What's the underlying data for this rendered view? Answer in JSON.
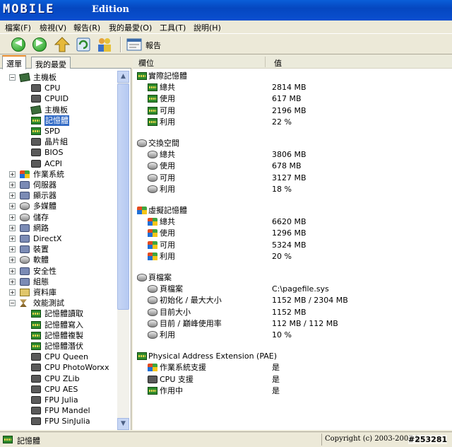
{
  "window": {
    "logo": "MOBILE",
    "edition": "Edition"
  },
  "menu": [
    "檔案(F)",
    "檢視(V)",
    "報告(R)",
    "我的最愛(O)",
    "工具(T)",
    "說明(H)"
  ],
  "toolbar": {
    "report_label": "報告"
  },
  "tabs": [
    "選單",
    "我的最愛"
  ],
  "tree": [
    {
      "label": "主機板",
      "icon": "board",
      "level": 1,
      "expander": "−"
    },
    {
      "label": "CPU",
      "icon": "chip",
      "level": 2
    },
    {
      "label": "CPUID",
      "icon": "chip",
      "level": 2
    },
    {
      "label": "主機板",
      "icon": "board",
      "level": 2
    },
    {
      "label": "記憶體",
      "icon": "ram",
      "level": 2,
      "selected": true
    },
    {
      "label": "SPD",
      "icon": "ram",
      "level": 2
    },
    {
      "label": "晶片組",
      "icon": "chip",
      "level": 2
    },
    {
      "label": "BIOS",
      "icon": "chip",
      "level": 2
    },
    {
      "label": "ACPI",
      "icon": "chip",
      "level": 2
    },
    {
      "label": "作業系統",
      "icon": "win",
      "level": 1,
      "expander": "+"
    },
    {
      "label": "伺服器",
      "icon": "gen",
      "level": 1,
      "expander": "+"
    },
    {
      "label": "顯示器",
      "icon": "gen",
      "level": 1,
      "expander": "+"
    },
    {
      "label": "多媒體",
      "icon": "disk",
      "level": 1,
      "expander": "+"
    },
    {
      "label": "儲存",
      "icon": "disk",
      "level": 1,
      "expander": "+"
    },
    {
      "label": "網路",
      "icon": "gen",
      "level": 1,
      "expander": "+"
    },
    {
      "label": "DirectX",
      "icon": "gen",
      "level": 1,
      "expander": "+"
    },
    {
      "label": "裝置",
      "icon": "gen",
      "level": 1,
      "expander": "+"
    },
    {
      "label": "軟體",
      "icon": "disk",
      "level": 1,
      "expander": "+"
    },
    {
      "label": "安全性",
      "icon": "gen",
      "level": 1,
      "expander": "+"
    },
    {
      "label": "組態",
      "icon": "gen",
      "level": 1,
      "expander": "+"
    },
    {
      "label": "資料庫",
      "icon": "folder",
      "level": 1,
      "expander": "+"
    },
    {
      "label": "效能測試",
      "icon": "hour",
      "level": 1,
      "expander": "−"
    },
    {
      "label": "記憶體讀取",
      "icon": "ram",
      "level": 2
    },
    {
      "label": "記憶體寫入",
      "icon": "ram",
      "level": 2
    },
    {
      "label": "記憶體複製",
      "icon": "ram",
      "level": 2
    },
    {
      "label": "記憶體潛伏",
      "icon": "ram",
      "level": 2
    },
    {
      "label": "CPU Queen",
      "icon": "chip",
      "level": 2
    },
    {
      "label": "CPU PhotoWorxx",
      "icon": "chip",
      "level": 2
    },
    {
      "label": "CPU ZLib",
      "icon": "chip",
      "level": 2
    },
    {
      "label": "CPU AES",
      "icon": "chip",
      "level": 2
    },
    {
      "label": "FPU Julia",
      "icon": "chip",
      "level": 2
    },
    {
      "label": "FPU Mandel",
      "icon": "chip",
      "level": 2
    },
    {
      "label": "FPU SinJulia",
      "icon": "chip",
      "level": 2
    }
  ],
  "columns": {
    "field": "欄位",
    "value": "值"
  },
  "sections": [
    {
      "title": "實際記憶體",
      "icon": "ram",
      "rows": [
        {
          "label": "總共",
          "value": "2814 MB",
          "icon": "ram"
        },
        {
          "label": "使用",
          "value": "617 MB",
          "icon": "ram"
        },
        {
          "label": "可用",
          "value": "2196 MB",
          "icon": "ram"
        },
        {
          "label": "利用",
          "value": "22 %",
          "icon": "ram"
        }
      ]
    },
    {
      "title": "交換空間",
      "icon": "disk",
      "rows": [
        {
          "label": "總共",
          "value": "3806 MB",
          "icon": "disk"
        },
        {
          "label": "使用",
          "value": "678 MB",
          "icon": "disk"
        },
        {
          "label": "可用",
          "value": "3127 MB",
          "icon": "disk"
        },
        {
          "label": "利用",
          "value": "18 %",
          "icon": "disk"
        }
      ]
    },
    {
      "title": "虛擬記憶體",
      "icon": "win",
      "rows": [
        {
          "label": "總共",
          "value": "6620 MB",
          "icon": "win"
        },
        {
          "label": "使用",
          "value": "1296 MB",
          "icon": "win"
        },
        {
          "label": "可用",
          "value": "5324 MB",
          "icon": "win"
        },
        {
          "label": "利用",
          "value": "20 %",
          "icon": "win"
        }
      ]
    },
    {
      "title": "頁檔案",
      "icon": "disk",
      "rows": [
        {
          "label": "頁檔案",
          "value": "C:\\pagefile.sys",
          "icon": "disk"
        },
        {
          "label": "初始化 / 最大大小",
          "value": "1152 MB / 2304 MB",
          "icon": "disk"
        },
        {
          "label": "目前大小",
          "value": "1152 MB",
          "icon": "disk"
        },
        {
          "label": "目前 / 巔峰使用率",
          "value": "112 MB / 112 MB",
          "icon": "disk"
        },
        {
          "label": "利用",
          "value": "10 %",
          "icon": "disk"
        }
      ]
    },
    {
      "title": "Physical Address Extension (PAE)",
      "icon": "ram",
      "rows": [
        {
          "label": "作業系統支援",
          "value": "是",
          "icon": "win"
        },
        {
          "label": "CPU 支援",
          "value": "是",
          "icon": "chip"
        },
        {
          "label": "作用中",
          "value": "是",
          "icon": "ram"
        }
      ]
    }
  ],
  "status": {
    "left": "記憶體",
    "right": "Copyright (c) 2003-2007 L",
    "image_id": "#253281"
  }
}
